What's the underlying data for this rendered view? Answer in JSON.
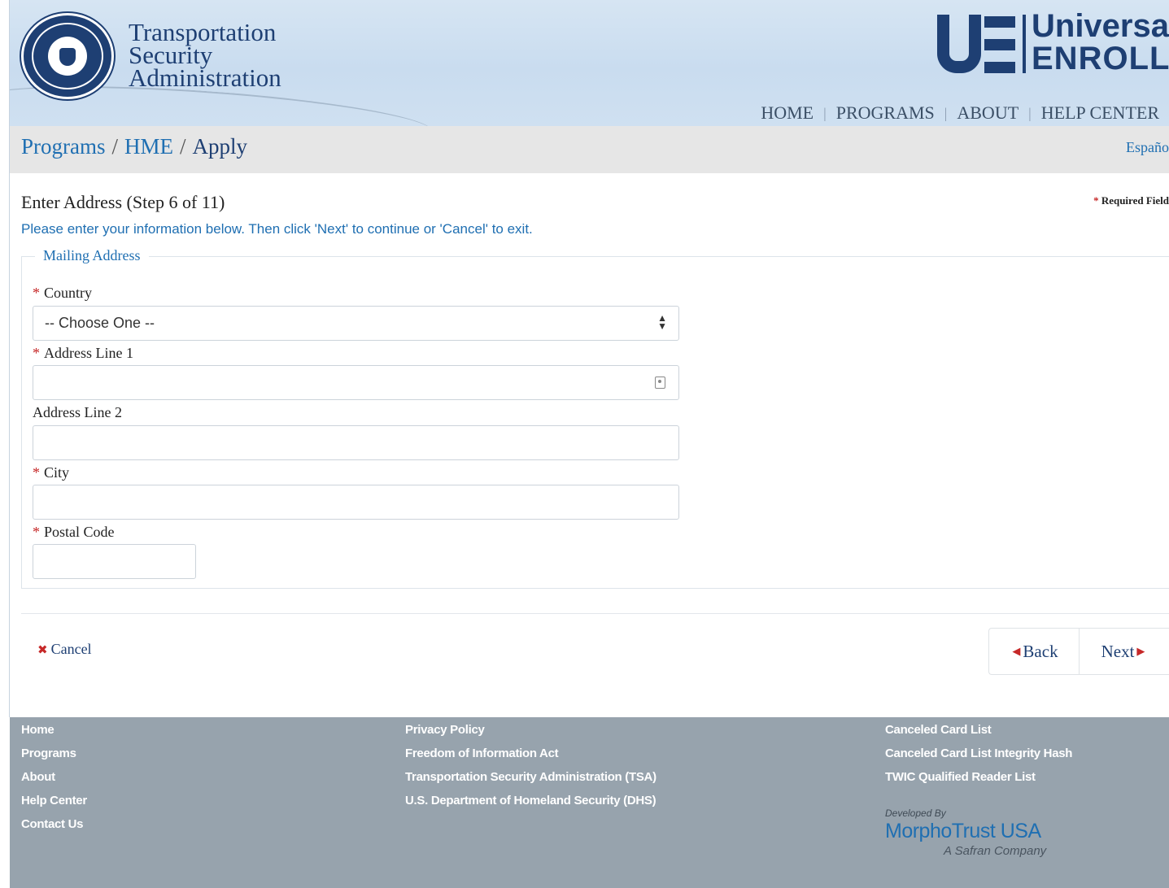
{
  "header": {
    "agency_name": [
      "Transportation",
      "Security",
      "Administration"
    ],
    "brand_line1": "Universal",
    "brand_line2": "ENROLL",
    "nav": [
      "HOME",
      "PROGRAMS",
      "ABOUT",
      "HELP CENTER"
    ]
  },
  "breadcrumb": {
    "items": [
      "Programs",
      "HME",
      "Apply"
    ],
    "language": "Españo"
  },
  "form": {
    "step_title": "Enter Address (Step 6 of 11)",
    "required_note": "Required Field",
    "instructions": "Please enter your information below. Then click 'Next' to continue or 'Cancel' to exit.",
    "legend": "Mailing Address",
    "country": {
      "label": "Country",
      "value": "-- Choose One --",
      "required": true
    },
    "address1": {
      "label": "Address Line 1",
      "value": "",
      "required": true
    },
    "address2": {
      "label": "Address Line 2",
      "value": "",
      "required": false
    },
    "city": {
      "label": "City",
      "value": "",
      "required": true
    },
    "postal": {
      "label": "Postal Code",
      "value": "",
      "required": true
    },
    "cancel_label": "Cancel",
    "back_label": "Back",
    "next_label": "Next"
  },
  "footer": {
    "col1": [
      "Home",
      "Programs",
      "About",
      "Help Center",
      "Contact Us"
    ],
    "col2": [
      "Privacy Policy",
      "Freedom of Information Act",
      "Transportation Security Administration (TSA)",
      "U.S. Department of Homeland Security (DHS)"
    ],
    "col3": [
      "Canceled Card List",
      "Canceled Card List Integrity Hash",
      "TWIC Qualified Reader List"
    ],
    "developed_by": "Developed By",
    "developer": "MorphoTrust USA",
    "developer_sub": "A Safran Company"
  },
  "icons": {
    "seal": "dhs-seal-icon",
    "autofill": "contact-card-icon",
    "select": "up-down-arrows-icon",
    "cancel": "x-icon",
    "back": "triangle-left-icon",
    "next": "triangle-right-icon"
  },
  "colors": {
    "brand_navy": "#1e3f73",
    "link_blue": "#1f6fb2",
    "required_red": "#c62828",
    "footer_gray": "#97a3ad",
    "breadcrumb_gray": "#e6e6e6"
  }
}
